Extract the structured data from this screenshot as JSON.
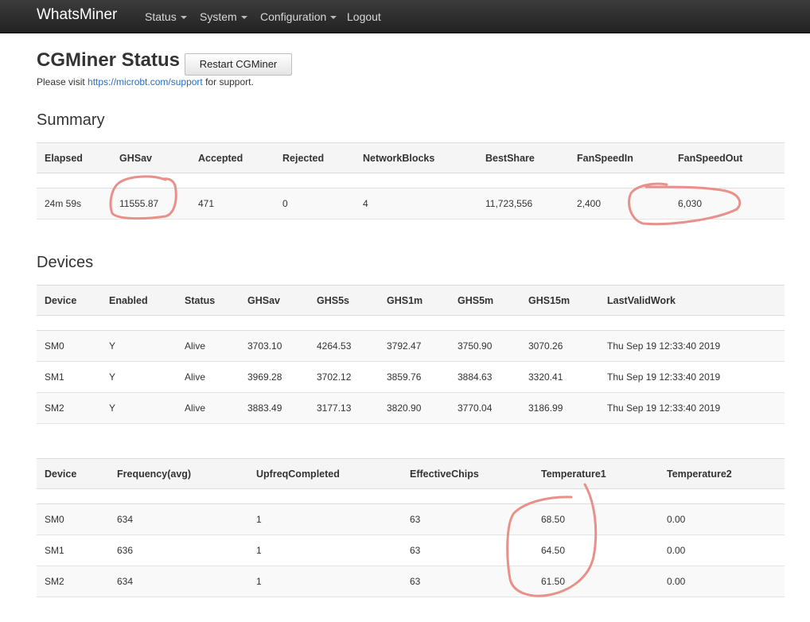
{
  "navbar": {
    "brand": "WhatsMiner",
    "items": [
      {
        "label": "Status",
        "dropdown": true
      },
      {
        "label": "System",
        "dropdown": true
      },
      {
        "label": "Configuration",
        "dropdown": true
      },
      {
        "label": "Logout",
        "dropdown": false
      }
    ]
  },
  "page": {
    "title": "CGMiner Status",
    "restart_label": "Restart CGMiner",
    "support_prefix": "Please visit ",
    "support_link": "https://microbt.com/support",
    "support_suffix": " for support."
  },
  "summary": {
    "title": "Summary",
    "headers": [
      "Elapsed",
      "GHSav",
      "Accepted",
      "Rejected",
      "NetworkBlocks",
      "BestShare",
      "FanSpeedIn",
      "FanSpeedOut"
    ],
    "rows": [
      [
        "24m 59s",
        "11555.87",
        "471",
        "0",
        "4",
        "11,723,556",
        "2,400",
        "6,030"
      ]
    ]
  },
  "devices": {
    "title": "Devices",
    "headers": [
      "Device",
      "Enabled",
      "Status",
      "GHSav",
      "GHS5s",
      "GHS1m",
      "GHS5m",
      "GHS15m",
      "LastValidWork"
    ],
    "rows": [
      [
        "SM0",
        "Y",
        "Alive",
        "3703.10",
        "4264.53",
        "3792.47",
        "3750.90",
        "3070.26",
        "Thu Sep 19 12:33:40 2019"
      ],
      [
        "SM1",
        "Y",
        "Alive",
        "3969.28",
        "3702.12",
        "3859.76",
        "3884.63",
        "3320.41",
        "Thu Sep 19 12:33:40 2019"
      ],
      [
        "SM2",
        "Y",
        "Alive",
        "3883.49",
        "3177.13",
        "3820.90",
        "3770.04",
        "3186.99",
        "Thu Sep 19 12:33:40 2019"
      ]
    ]
  },
  "devices_detail": {
    "headers": [
      "Device",
      "Frequency(avg)",
      "UpfreqCompleted",
      "EffectiveChips",
      "Temperature1",
      "Temperature2"
    ],
    "rows": [
      [
        "SM0",
        "634",
        "1",
        "63",
        "68.50",
        "0.00"
      ],
      [
        "SM1",
        "636",
        "1",
        "63",
        "64.50",
        "0.00"
      ],
      [
        "SM2",
        "634",
        "1",
        "63",
        "61.50",
        "0.00"
      ]
    ]
  },
  "colors": {
    "navbar": "#222222",
    "link": "#2a6dbd",
    "annotation": "#e8908a"
  }
}
